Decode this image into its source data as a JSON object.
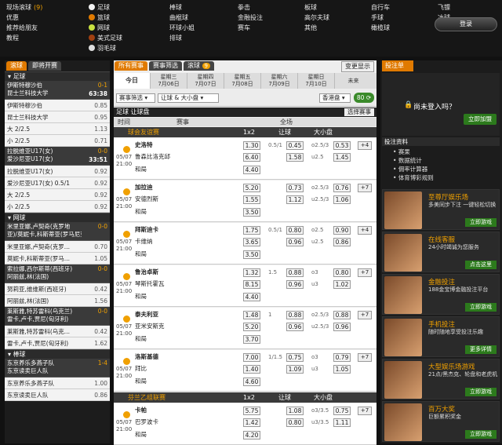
{
  "top": {
    "col1": [
      "现场滚球",
      "优惠",
      "推荐给朋友",
      "教程"
    ],
    "col1_badge": "(9)",
    "col2": [
      "足球",
      "篮球",
      "网球",
      "美式足球",
      "羽毛球"
    ],
    "col3": [
      "棒球",
      "曲棍球",
      "环球小姐",
      "排球"
    ],
    "col4": [
      "拳击",
      "金融投注",
      "赛车"
    ],
    "col5": [
      "板球",
      "高尔夫球",
      "其他"
    ],
    "col6": [
      "自行车",
      "手球",
      "橄榄球"
    ],
    "col7": [
      "飞镖",
      "冰球",
      "台球"
    ],
    "login": "登录"
  },
  "left": {
    "tabs": [
      "滚球",
      "即将开赛"
    ],
    "soccer_header": "足球",
    "tennis_header": "网球",
    "bb_header": "棒球",
    "soccer": [
      {
        "type": "live",
        "t1": "伊斯特穆沙伯",
        "t2": "昆士兰科技大学",
        "score": "0-1",
        "time": "63:38"
      },
      {
        "type": "row",
        "n": "伊斯特穆沙伯",
        "o": "0.85"
      },
      {
        "type": "row",
        "n": "昆士兰科技大学",
        "o": "0.95"
      },
      {
        "type": "row",
        "n": "大 2/2.5",
        "o": "1.13"
      },
      {
        "type": "row",
        "n": "小 2/2.5",
        "o": "0.71"
      },
      {
        "type": "live",
        "t1": "拉脱维亚U17(女)",
        "t2": "爱沙尼亚U17(女)",
        "score": "0-0",
        "time": "33:51"
      },
      {
        "type": "row",
        "n": "拉脱维亚U17(女)",
        "o": "0.92"
      },
      {
        "type": "row",
        "n": "爱沙尼亚U17(女) 0.5/1",
        "o": "0.92"
      },
      {
        "type": "row",
        "n": "大 2/2.5",
        "o": "0.92"
      },
      {
        "type": "row",
        "n": "小 2/2.5",
        "o": "0.92"
      }
    ],
    "tennis": [
      {
        "type": "live",
        "t1": "米里亚娜,卢契奇(克罗地",
        "t2": "亚)/莫妮卡,科斯蒂亚(罗马尼亚)",
        "score": "0-0"
      },
      {
        "type": "row",
        "n": "米里亚娜,卢契奇(克罗...",
        "o": "0.70"
      },
      {
        "type": "row",
        "n": "莫妮卡,科斯蒂亚(罗马...",
        "o": "1.05"
      },
      {
        "type": "live",
        "t1": "索拉娜,西尔斯蒂(西班牙)",
        "t2": "阿丽兹,林(法国)",
        "score": "0-0"
      },
      {
        "type": "row",
        "n": "努莉亚,维维斯(西班牙)",
        "o": "0.42"
      },
      {
        "type": "row",
        "n": "阿丽兹,林(法国)",
        "o": "1.56"
      },
      {
        "type": "live",
        "t1": "莱斯雅,特苏雷科(乌克兰)",
        "t2": "雷卡,卢卡,贾尼(匈牙利)",
        "score": "0-0"
      },
      {
        "type": "row",
        "n": "莱斯雅,特苏雷科(乌克...",
        "o": "0.42"
      },
      {
        "type": "row",
        "n": "雷卡,卢卡,贾尼(匈牙利)",
        "o": "1.62"
      }
    ],
    "baseball": [
      {
        "type": "live",
        "t1": "东京养乐多燕子队",
        "t2": "东京读卖巨人队",
        "score": "1-4"
      },
      {
        "type": "row",
        "n": "东京养乐多燕子队",
        "o": "1.00"
      },
      {
        "type": "row",
        "n": "东京读卖巨人队",
        "o": "0.86"
      }
    ]
  },
  "mid": {
    "tabs": [
      "所有赛事",
      "赛事筛选",
      "滚球"
    ],
    "tab_badge": "9",
    "btn": "变更显示",
    "today": "今日",
    "dates": [
      [
        "星期三",
        "7月06日"
      ],
      [
        "星期四",
        "7月07日"
      ],
      [
        "星期五",
        "7月08日"
      ],
      [
        "星期六",
        "7月09日"
      ],
      [
        "星期日",
        "7月10日"
      ]
    ],
    "future": "未来",
    "filter1": "赛事筛选",
    "filter2": "让球 & 大小盘",
    "odds_fmt": "香港盘",
    "count": "80",
    "bar1": "足球 让球盘",
    "select_btn": "选择赛事",
    "col_time": "时间",
    "col_match": "赛事",
    "col_full": "全场",
    "col_1x2": "1x2",
    "col_hdp": "让球",
    "col_ou": "大小盘",
    "league1": "球会友谊赛",
    "league2": "芬兰乙组联赛",
    "matches": [
      {
        "date": "05/07",
        "time": "21:00",
        "h": "史洛特",
        "a": "鲁森比洛克邱",
        "draw": "和局",
        "o1": "1.30",
        "o2": "6.40",
        "ox": "4.40",
        "hc": "0.5/1",
        "hh": "0.45",
        "ha": "1.58",
        "ou1": "o2.5/3",
        "ou2": "u2.5",
        "oh": "0.53",
        "oa": "1.45",
        "plus": "+4"
      },
      {
        "date": "05/07",
        "time": "21:00",
        "h": "加拉迪",
        "a": "安德烈斯",
        "draw": "和局",
        "o1": "5.20",
        "o2": "1.55",
        "ox": "3.50",
        "hc": "",
        "hh": "0.73",
        "ha": "1.12",
        "ou1": "o2.5/3",
        "ou2": "u2.5/3",
        "oh": "0.76",
        "oa": "1.06",
        "plus": "+7"
      },
      {
        "date": "05/07",
        "time": "21:00",
        "h": "拜斯迪卡",
        "a": "卡维纳",
        "draw": "和局",
        "o1": "1.75",
        "o2": "3.65",
        "ox": "3.50",
        "hc": "0.5/1",
        "hh": "0.80",
        "ha": "0.96",
        "ou1": "o2.5",
        "ou2": "u2.5",
        "oh": "0.90",
        "oa": "0.86",
        "plus": "+4"
      },
      {
        "date": "05/07",
        "time": "21:00",
        "h": "鲁治卓斯",
        "a": "琴斯托霍瓦",
        "draw": "和局",
        "o1": "1.32",
        "o2": "8.15",
        "ox": "4.40",
        "hc": "1.5",
        "hh": "0.88",
        "ha": "0.96",
        "ou1": "o3",
        "ou2": "u3",
        "oh": "0.80",
        "oa": "1.02",
        "plus": "+7"
      },
      {
        "date": "05/07",
        "time": "21:00",
        "h": "泰夫利亚",
        "a": "亚米安斯克",
        "draw": "和局",
        "o1": "1.48",
        "o2": "5.20",
        "ox": "3.70",
        "hc": "1",
        "hh": "0.88",
        "ha": "0.96",
        "ou1": "o2.5/3",
        "ou2": "u2.5/3",
        "oh": "0.88",
        "oa": "0.96",
        "plus": "+7"
      },
      {
        "date": "05/07",
        "time": "21:00",
        "h": "洛斯基德",
        "a": "拜比",
        "draw": "和局",
        "o1": "7.00",
        "o2": "1.40",
        "ox": "4.60",
        "hc": "1/1.5",
        "hh": "0.75",
        "ha": "1.09",
        "ou1": "o3",
        "ou2": "u3",
        "oh": "0.79",
        "oa": "1.05",
        "plus": "+7"
      },
      {
        "date": "05/07",
        "time": "21:00",
        "h": "卡帕",
        "a": "巴罗波卡",
        "draw": "和局",
        "o1": "5.75",
        "o2": "1.42",
        "ox": "4.20",
        "hc": "",
        "hh": "1.08",
        "ha": "0.80",
        "ou1": "o3/3.5",
        "ou2": "u3/3.5",
        "oh": "0.75",
        "oa": "1.11",
        "plus": "+7"
      }
    ]
  },
  "right": {
    "tab": "投注单",
    "not_logged": "尚未登入吗？",
    "join": "立即加盟",
    "info_h": "投注资料",
    "info": [
      "赛果",
      "数据统计",
      "佣率计算器",
      "体育博彩规则"
    ],
    "promos": [
      {
        "t": "至尊厅娱乐场",
        "s": "多美同步下注 一键轻松切换",
        "b": "立即游戏"
      },
      {
        "t": "在线客服",
        "s": "24小时竭诚为您服务",
        "b": "点击这里"
      },
      {
        "t": "金融投注",
        "s": "188金宝博金融投注平台",
        "b": "立即游戏"
      },
      {
        "t": "手机投注",
        "s": "随时随地享受投注乐趣",
        "b": "更多详情"
      },
      {
        "t": "大型娱乐场游戏",
        "s": "21点/黑杰克、轮盘和老虎机",
        "b": "立即游戏"
      },
      {
        "t": "百万大奖",
        "s": "巨额累积奖金",
        "b": "立即游戏"
      }
    ]
  }
}
